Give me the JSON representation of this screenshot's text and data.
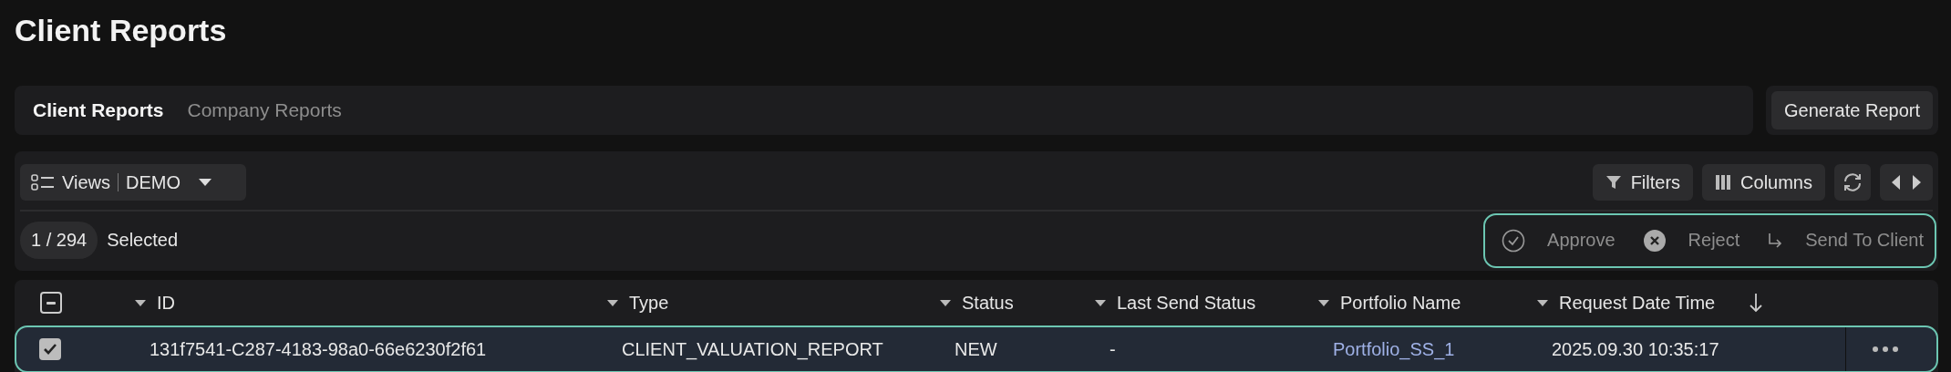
{
  "page_title": "Client Reports",
  "tabs": [
    {
      "label": "Client Reports",
      "selected": true
    },
    {
      "label": "Company Reports",
      "selected": false
    }
  ],
  "generate_button": "Generate Report",
  "views": {
    "label": "Views",
    "value": "DEMO"
  },
  "toolbar": [
    {
      "kind": "filters",
      "label": "Filters"
    },
    {
      "kind": "columns",
      "label": "Columns"
    },
    {
      "kind": "refresh"
    },
    {
      "kind": "paging"
    }
  ],
  "selection": {
    "count": "1 / 294",
    "label": "Selected"
  },
  "bulk_actions": [
    {
      "kind": "approve",
      "label": "Approve"
    },
    {
      "kind": "reject",
      "label": "Reject"
    },
    {
      "kind": "send",
      "label": "Send To Client"
    }
  ],
  "table": {
    "header_checkbox": {
      "partial": true
    },
    "columns": [
      {
        "label": "ID",
        "sorted": false
      },
      {
        "label": "Type",
        "sorted": false
      },
      {
        "label": "Status",
        "sorted": false
      },
      {
        "label": "Last Send Status",
        "sorted": false
      },
      {
        "label": "Portfolio Name",
        "sorted": false
      },
      {
        "label": "Request Date Time",
        "sorted": true
      }
    ],
    "rows": [
      {
        "checked": true,
        "selected": true,
        "cells": [
          {
            "kind": "text",
            "text": "131f7541-C287-4183-98a0-66e6230f2f61"
          },
          {
            "kind": "text",
            "text": "CLIENT_VALUATION_REPORT"
          },
          {
            "kind": "text",
            "text": "NEW"
          },
          {
            "kind": "text",
            "text": "-"
          },
          {
            "kind": "link",
            "text": "Portfolio_SS_1"
          },
          {
            "kind": "text",
            "text": "2025.09.30 10:35:17"
          }
        ]
      }
    ]
  }
}
